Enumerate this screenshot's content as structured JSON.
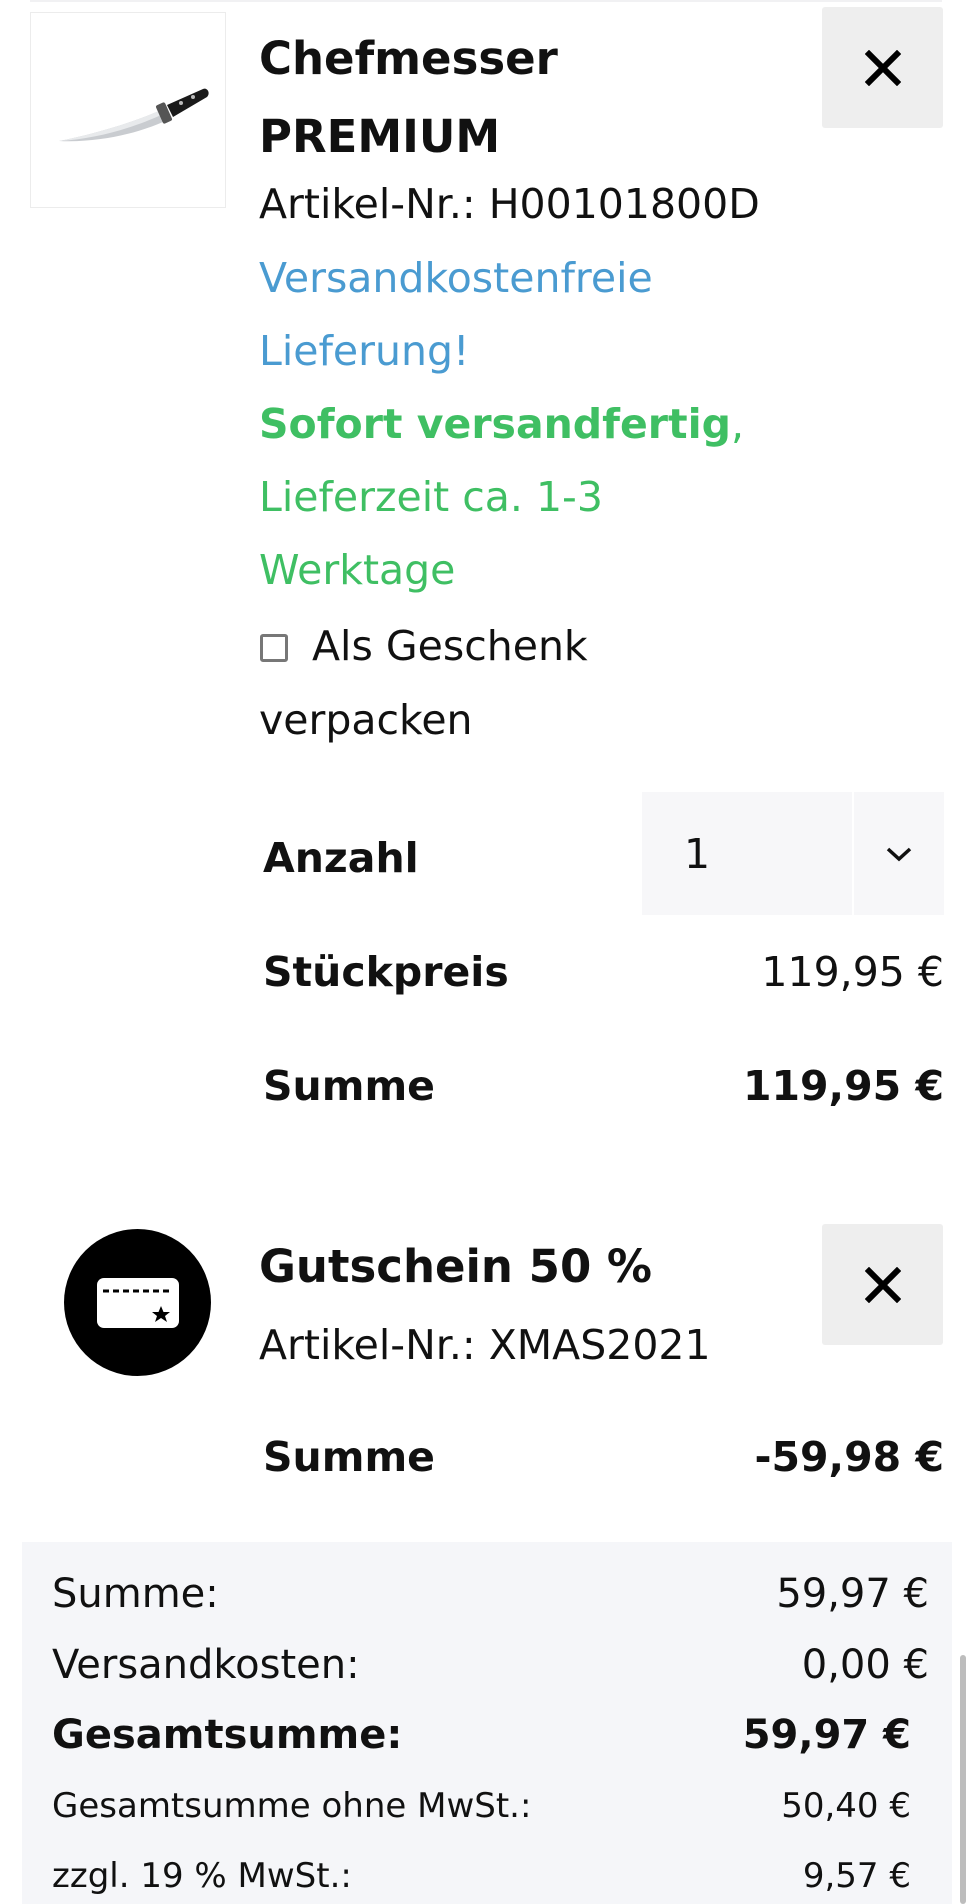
{
  "items": [
    {
      "name_line1": "Chefmesser",
      "name_line2": "PREMIUM",
      "article": "Artikel-Nr.: H00101800D",
      "shipping_free_line1": "Versandkostenfreie",
      "shipping_free_line2": "Lieferung!",
      "availability_bold": "Sofort versandfertig",
      "availability_comma": ",",
      "delivery_line1": "Lieferzeit ca. 1-3",
      "delivery_line2": "Werktage",
      "gift_line1": "Als Geschenk",
      "gift_line2": "verpacken",
      "gift_checked": false,
      "quantity_label": "Anzahl",
      "quantity_value": "1",
      "unit_price_label": "Stückpreis",
      "unit_price": "119,95 €",
      "sum_label": "Summe",
      "sum": "119,95 €",
      "image_icon": "chef-knife-image"
    },
    {
      "name": "Gutschein 50 %",
      "article": "Artikel-Nr.: XMAS2021",
      "sum_label": "Summe",
      "sum": "-59,98 €",
      "icon": "voucher-card-icon"
    }
  ],
  "remove_icon": "close-icon",
  "totals": {
    "subtotal_label": "Summe:",
    "subtotal": "59,97 €",
    "shipping_label": "Versandkosten:",
    "shipping": "0,00 €",
    "grand_total_label": "Gesamtsumme:",
    "grand_total": "59,97 €",
    "net_label": "Gesamtsumme ohne MwSt.:",
    "net": "50,40 €",
    "vat_label": "zzgl. 19 % MwSt.:",
    "vat": "9,57 €"
  },
  "colors": {
    "blue_text": "#4a9bd1",
    "green_text": "#3fbf63",
    "button_bg": "#eeeeee",
    "totals_bg": "#f5f6f9"
  }
}
